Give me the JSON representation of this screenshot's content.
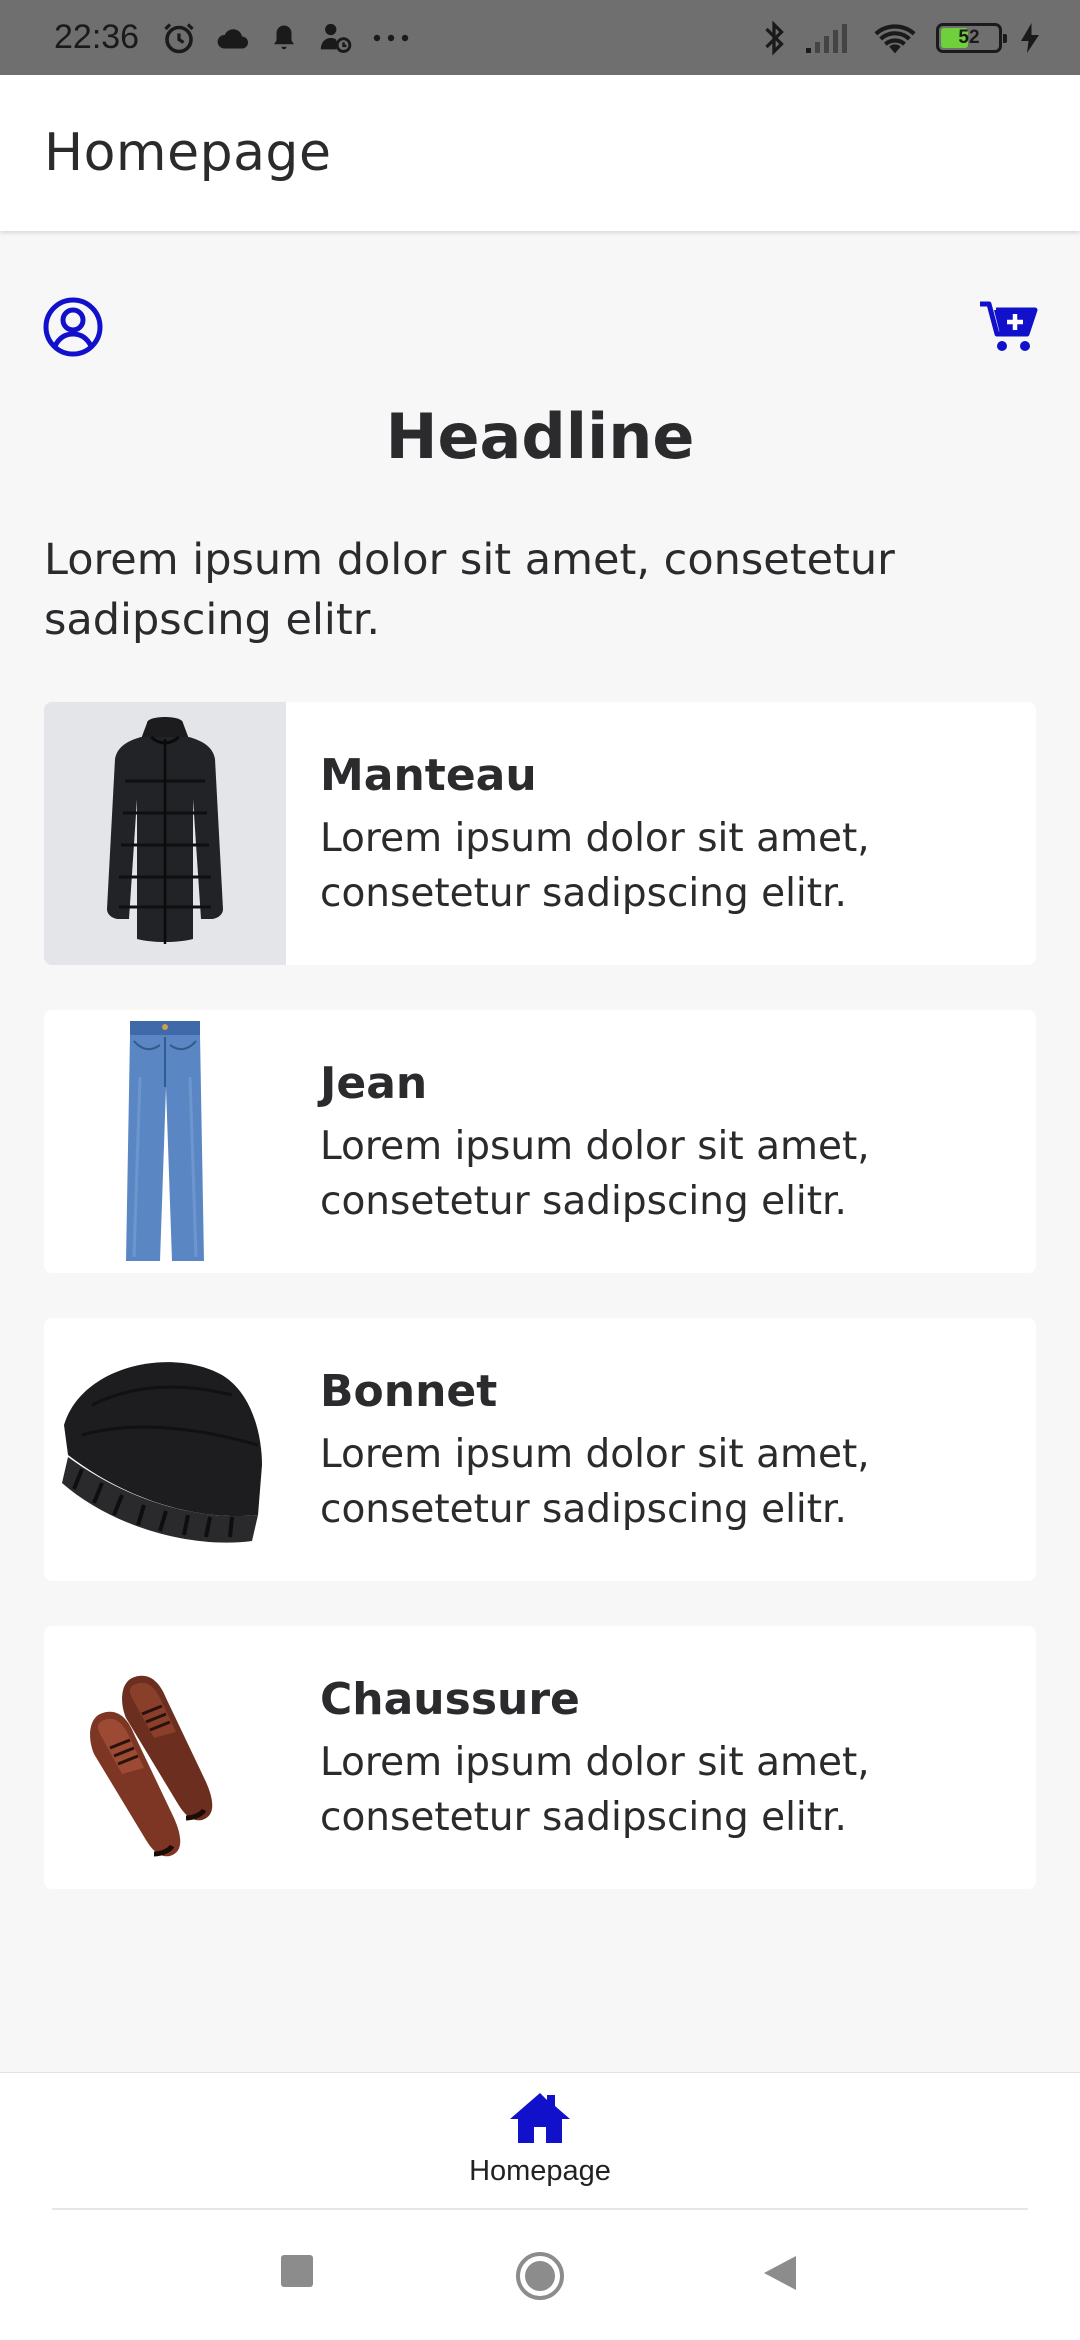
{
  "status_bar": {
    "time": "22:36",
    "battery_level": "52",
    "battery_fraction": 0.52,
    "left_icons": [
      "alarm-icon",
      "cloud-icon",
      "notification-bell-icon",
      "user-sync-icon",
      "more-dots-icon"
    ],
    "right_icons": [
      "bluetooth-icon",
      "signal-icon",
      "wifi-icon",
      "battery-icon",
      "charging-icon"
    ]
  },
  "app_bar": {
    "title": "Homepage"
  },
  "header_actions": {
    "profile_icon": "user-circle-icon",
    "cart_icon": "cart-plus-icon"
  },
  "colors": {
    "accent": "#1111cc",
    "background": "#f7f7f8",
    "card": "#ffffff",
    "text": "#2b2b2e"
  },
  "main": {
    "headline": "Headline",
    "intro": "Lorem ipsum dolor sit amet, consetetur sadipscing elitr.",
    "products": [
      {
        "title": "Manteau",
        "description": "Lorem ipsum dolor sit amet, consetetur sadipscing elitr.",
        "image": "coat-image"
      },
      {
        "title": "Jean",
        "description": "Lorem ipsum dolor sit amet, consetetur sadipscing elitr.",
        "image": "jeans-image"
      },
      {
        "title": "Bonnet",
        "description": "Lorem ipsum dolor sit amet, consetetur sadipscing elitr.",
        "image": "beanie-image"
      },
      {
        "title": "Chaussure",
        "description": "Lorem ipsum dolor sit amet, consetetur sadipscing elitr.",
        "image": "shoes-image"
      }
    ]
  },
  "bottom_nav": {
    "items": [
      {
        "label": "Homepage",
        "icon": "home-icon",
        "active": true
      }
    ]
  },
  "system_nav": [
    "recents-button",
    "home-button",
    "back-button"
  ]
}
